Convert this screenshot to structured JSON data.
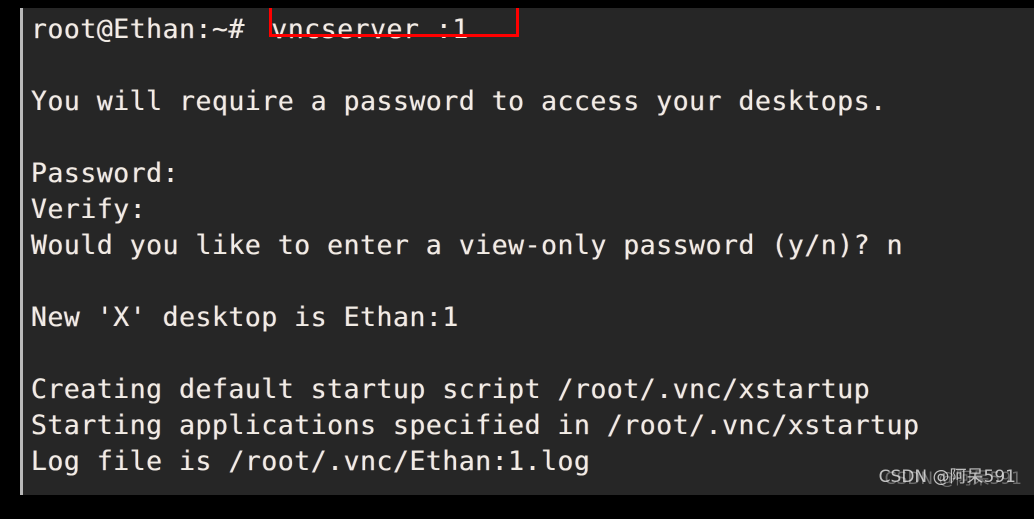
{
  "window": {
    "kind": "terminal-screenshot",
    "background_color": "#000000",
    "terminal_background_color": "#262626",
    "terminal_text_color": "#f2ece4",
    "left_rule_color": "#b9b9b9"
  },
  "terminal": {
    "prompt": "root@Ethan:~# ",
    "command": "vncserver :1",
    "highlight": {
      "color": "#ff0000",
      "target": "vncserver :1"
    },
    "lines": [
      {
        "text": "",
        "blank": true
      },
      {
        "text": "You will require a password to access your desktops.",
        "blank": false
      },
      {
        "text": "",
        "blank": true
      },
      {
        "text": "Password:",
        "blank": false
      },
      {
        "text": "Verify:",
        "blank": false
      },
      {
        "text": "Would you like to enter a view-only password (y/n)? n",
        "blank": false
      },
      {
        "text": "",
        "blank": true
      },
      {
        "text": "New 'X' desktop is Ethan:1",
        "blank": false
      },
      {
        "text": "",
        "blank": true
      },
      {
        "text": "Creating default startup script /root/.vnc/xstartup",
        "blank": false
      },
      {
        "text": "Starting applications specified in /root/.vnc/xstartup",
        "blank": false
      },
      {
        "text": "Log file is /root/.vnc/Ethan:1.log",
        "blank": false
      }
    ]
  },
  "watermark": {
    "text": "CSDN @阿呆591"
  }
}
